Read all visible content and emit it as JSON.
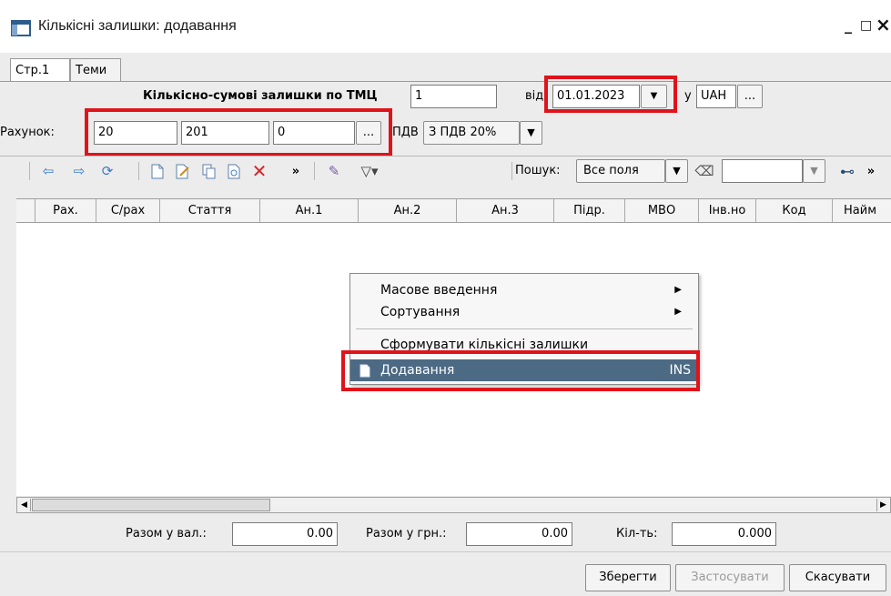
{
  "window": {
    "title": "Кількісні залишки: додавання",
    "minimize": "_",
    "maximize": "□",
    "close": "×"
  },
  "tabs": [
    {
      "label": "Стр.1",
      "active": true
    },
    {
      "label": "Теми",
      "active": false
    }
  ],
  "header": {
    "label": "Кількісно-сумові залишки по ТМЦ",
    "tmc_number": "1",
    "date_label": "від",
    "date": "01.01.2023",
    "currency_label": "у",
    "currency": "UAH",
    "browse": "..."
  },
  "account": {
    "label": "Рахунок:",
    "account": "20",
    "subaccount": "201",
    "extra": "0",
    "browse": "...",
    "vat_label": "ПДВ",
    "vat_value": "З ПДВ 20%"
  },
  "toolbar": {
    "more": "»",
    "search_label": "Пошук:",
    "search_scope": "Все поля",
    "search_value": "",
    "icons": [
      "back-arrow-icon",
      "forward-arrow-icon",
      "refresh-icon",
      "new-document-icon",
      "edit-icon",
      "copy-icon",
      "view-icon",
      "delete-icon",
      "wand-icon",
      "filter-icon",
      "eraser-icon",
      "binoculars-icon"
    ]
  },
  "grid": {
    "columns": [
      "Рах.",
      "С/рах",
      "Стаття",
      "Ан.1",
      "Ан.2",
      "Ан.3",
      "Підр.",
      "МВО",
      "Інв.но",
      "Код",
      "Найм"
    ],
    "rows": []
  },
  "context_menu": {
    "items": [
      {
        "label": "Масове введення",
        "submenu": true
      },
      {
        "label": "Сортування",
        "submenu": true
      },
      {
        "label": "Сформувати кількісні залишки",
        "submenu": false
      },
      {
        "label": "Додавання",
        "shortcut": "INS",
        "selected": true
      }
    ]
  },
  "totals": {
    "currency_label": "Разом у вал.:",
    "currency_value": "0.00",
    "uah_label": "Разом у грн.:",
    "uah_value": "0.00",
    "qty_label": "Кіл-ть:",
    "qty_value": "0.000"
  },
  "buttons": {
    "save": "Зберегти",
    "apply": "Застосувати",
    "cancel": "Скасувати"
  },
  "colors": {
    "highlight": "#e0131b",
    "menu_selected": "#4c6a84",
    "panel": "#ececec"
  }
}
